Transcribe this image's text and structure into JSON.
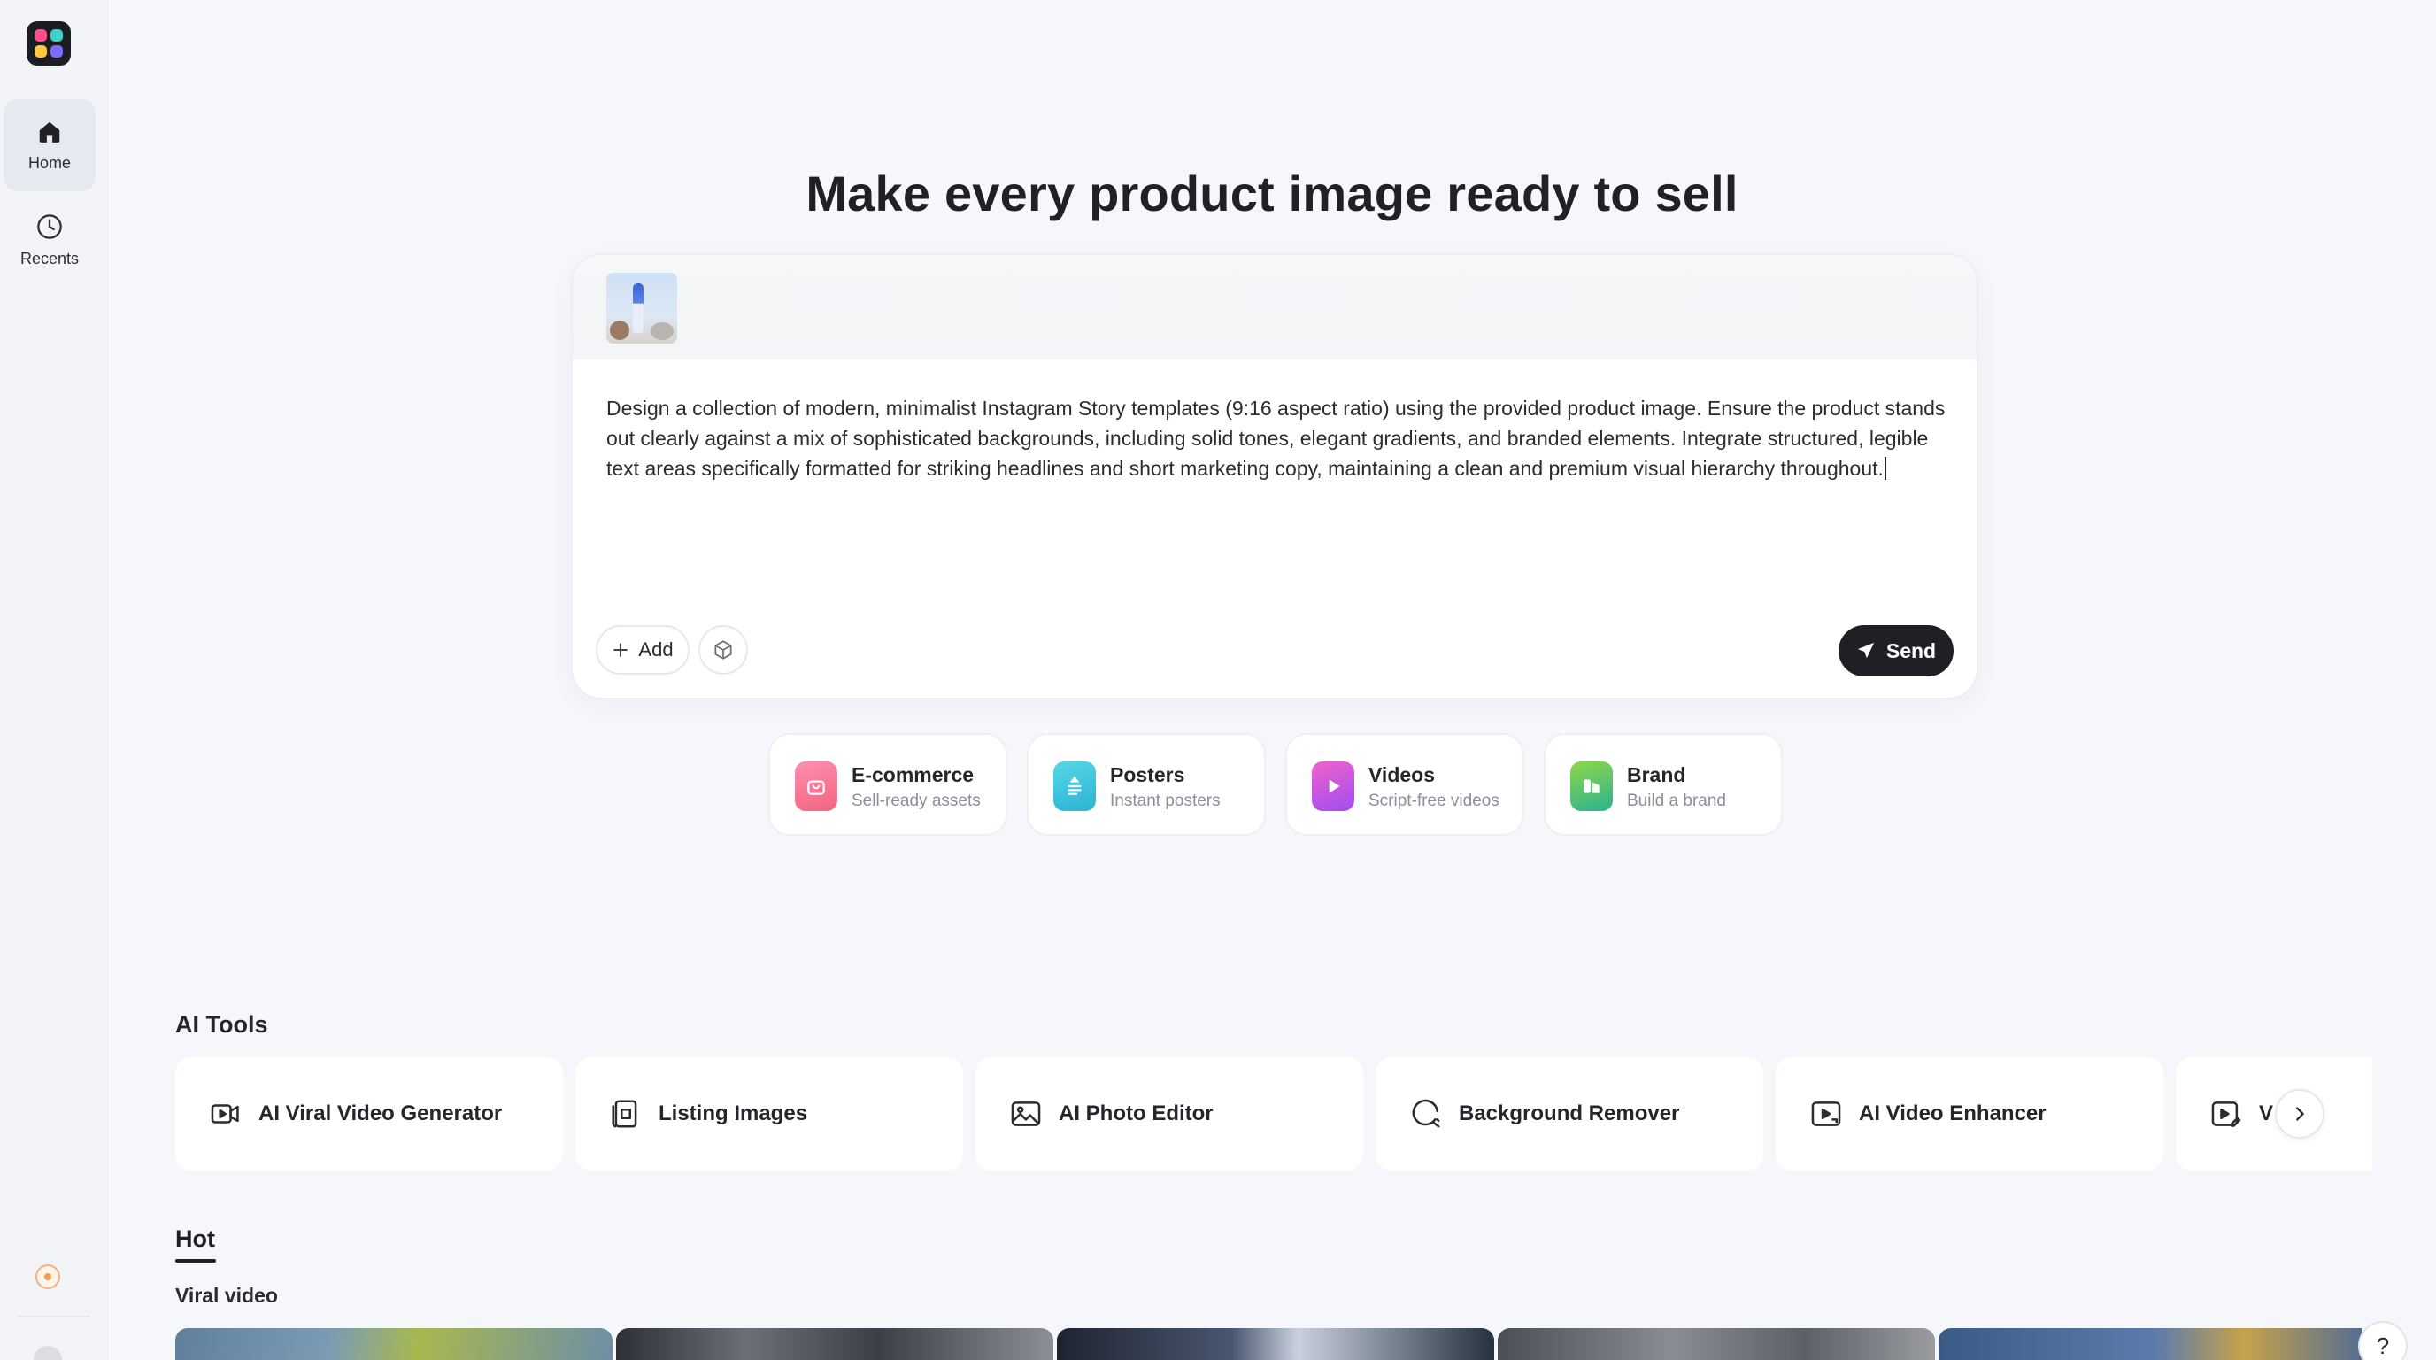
{
  "sidebar": {
    "items": [
      {
        "label": "Home",
        "icon": "home-icon",
        "active": true
      },
      {
        "label": "Recents",
        "icon": "clock-icon",
        "active": false
      }
    ]
  },
  "hero": {
    "title": "Make every product image ready to sell"
  },
  "composer": {
    "prompt": "Design a collection of modern, minimalist Instagram Story templates (9:16 aspect ratio) using the provided product image. Ensure the product stands out clearly against a mix of sophisticated backgrounds, including solid tones, elegant gradients, and branded elements. Integrate structured, legible text areas specifically formatted for striking headlines and short marketing copy, maintaining a clean and premium visual hierarchy throughout.",
    "add_label": "Add",
    "send_label": "Send"
  },
  "categories": [
    {
      "title": "E-commerce",
      "subtitle": "Sell-ready assets",
      "color": "#f27aa0"
    },
    {
      "title": "Posters",
      "subtitle": "Instant posters",
      "color": "#3fc4d8"
    },
    {
      "title": "Videos",
      "subtitle": "Script-free videos",
      "color": "#c35cf0"
    },
    {
      "title": "Brand",
      "subtitle": "Build a brand",
      "color": "#37c07a"
    }
  ],
  "ai_tools": {
    "heading": "AI Tools",
    "items": [
      {
        "label": "AI Viral Video Generator",
        "icon": "video-camera-icon"
      },
      {
        "label": "Listing Images",
        "icon": "listing-images-icon"
      },
      {
        "label": "AI Photo Editor",
        "icon": "photo-edit-icon"
      },
      {
        "label": "Background Remover",
        "icon": "background-remover-icon"
      },
      {
        "label": "AI Video Enhancer",
        "icon": "video-hd-icon"
      },
      {
        "label": "V",
        "icon": "video-edit-icon"
      }
    ]
  },
  "hot": {
    "tab": "Hot",
    "subheading": "Viral video"
  },
  "help": {
    "label": "?"
  }
}
